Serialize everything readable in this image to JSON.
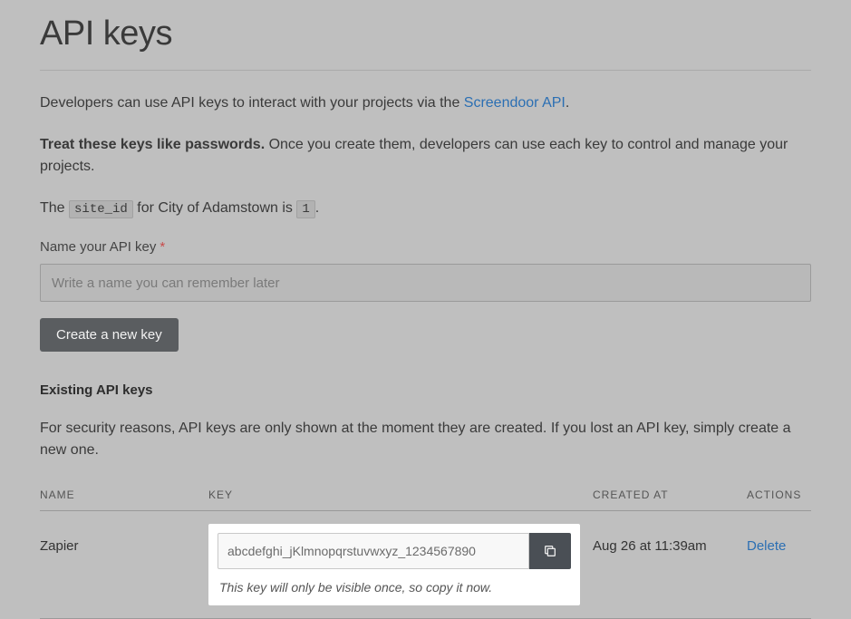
{
  "page": {
    "title": "API keys",
    "intro_prefix": "Developers can use API keys to interact with your projects via the ",
    "api_link_text": "Screendoor API",
    "intro_suffix": ".",
    "warn_bold": "Treat these keys like passwords.",
    "warn_rest": " Once you create them, developers can use each key to control and manage your projects.",
    "siteid_prefix": "The ",
    "siteid_code": "site_id",
    "siteid_mid": " for City of Adamstown is ",
    "siteid_value": "1",
    "siteid_suffix": "."
  },
  "form": {
    "label": "Name your API key",
    "required_mark": "*",
    "placeholder": "Write a name you can remember later",
    "create_button": "Create a new key"
  },
  "existing": {
    "heading": "Existing API keys",
    "security_note": "For security reasons, API keys are only shown at the moment they are created. If you lost an API key, simply create a new one."
  },
  "table": {
    "headers": {
      "name": "NAME",
      "key": "KEY",
      "created": "CREATED AT",
      "actions": "ACTIONS"
    },
    "rows": [
      {
        "name": "Zapier",
        "key_value": "abcdefghi_jKlmnopqrstuvwxyz_1234567890",
        "key_note": "This key will only be visible once, so copy it now.",
        "created_at": "Aug 26 at 11:39am",
        "delete_label": "Delete"
      }
    ]
  }
}
